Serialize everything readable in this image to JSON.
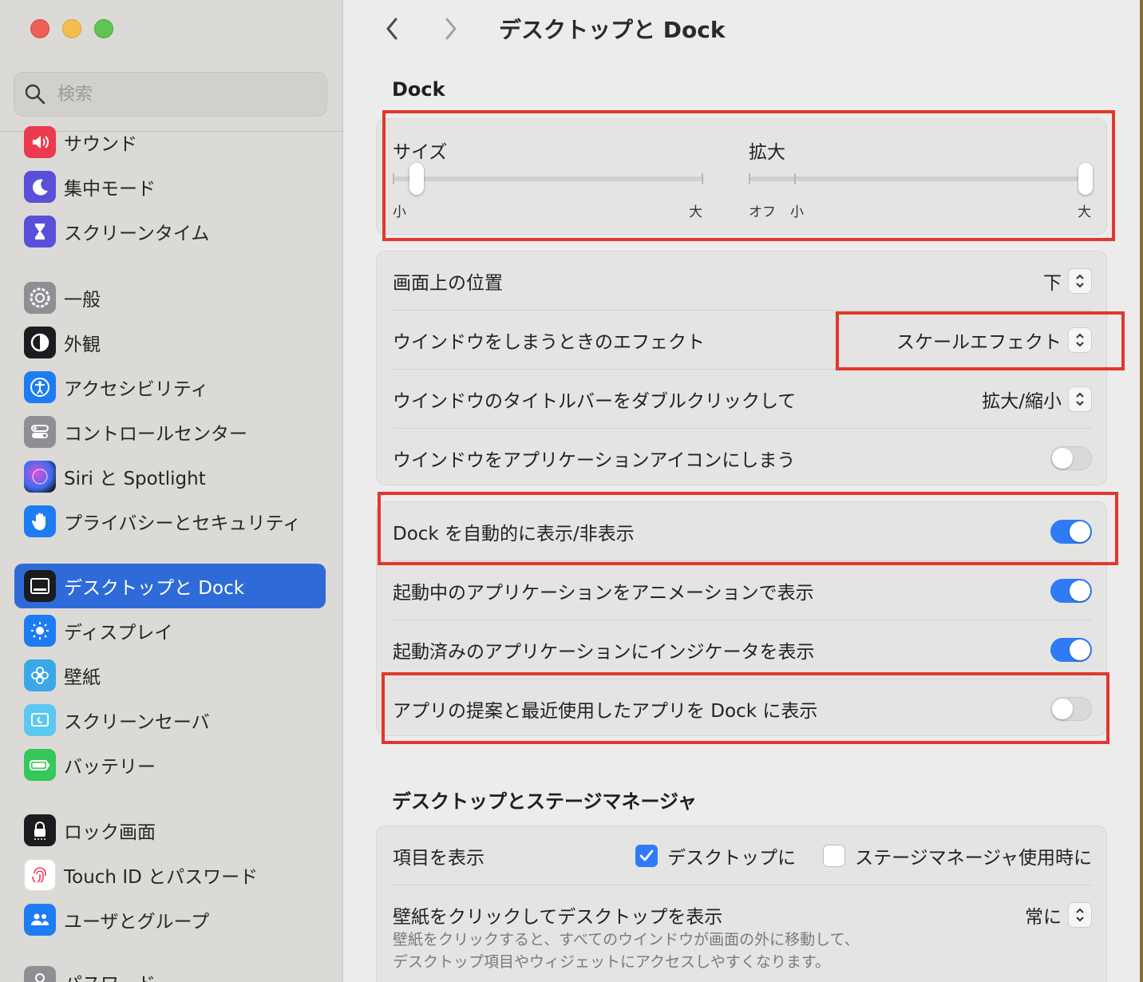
{
  "window": {
    "title": "デスクトップと Dock"
  },
  "search": {
    "placeholder": "検索"
  },
  "sidebar": {
    "items": [
      {
        "label": "サウンド",
        "icon": "speaker-icon"
      },
      {
        "label": "集中モード",
        "icon": "moon-icon"
      },
      {
        "label": "スクリーンタイム",
        "icon": "hourglass-icon"
      },
      {
        "label": "一般",
        "icon": "gear-icon"
      },
      {
        "label": "外観",
        "icon": "appearance-icon"
      },
      {
        "label": "アクセシビリティ",
        "icon": "accessibility-icon"
      },
      {
        "label": "コントロールセンター",
        "icon": "toggles-icon"
      },
      {
        "label": "Siri と Spotlight",
        "icon": "siri-icon"
      },
      {
        "label": "プライバシーとセキュリティ",
        "icon": "hand-icon"
      },
      {
        "label": "デスクトップと Dock",
        "icon": "dock-icon",
        "active": true
      },
      {
        "label": "ディスプレイ",
        "icon": "sun-icon"
      },
      {
        "label": "壁紙",
        "icon": "flower-icon"
      },
      {
        "label": "スクリーンセーバ",
        "icon": "screensaver-icon"
      },
      {
        "label": "バッテリー",
        "icon": "battery-icon"
      },
      {
        "label": "ロック画面",
        "icon": "lock-icon"
      },
      {
        "label": "Touch ID とパスワード",
        "icon": "fingerprint-icon"
      },
      {
        "label": "ユーザとグループ",
        "icon": "users-icon"
      },
      {
        "label": "パスワード",
        "icon": "key-icon"
      }
    ]
  },
  "dock": {
    "heading": "Dock",
    "size": {
      "label": "サイズ",
      "min_label": "小",
      "max_label": "大",
      "value": 0.03
    },
    "magnification": {
      "label": "拡大",
      "off_label": "オフ",
      "min_label": "小",
      "max_label": "大",
      "value": 1.0
    },
    "position": {
      "label": "画面上の位置",
      "value": "下"
    },
    "minimize_effect": {
      "label": "ウインドウをしまうときのエフェクト",
      "value": "スケールエフェクト"
    },
    "double_click": {
      "label": "ウインドウのタイトルバーをダブルクリックして",
      "value": "拡大/縮小"
    },
    "minimize_into_icon": {
      "label": "ウインドウをアプリケーションアイコンにしまう",
      "on": false
    },
    "autohide": {
      "label": "Dock を自動的に表示/非表示",
      "on": true
    },
    "animate": {
      "label": "起動中のアプリケーションをアニメーションで表示",
      "on": true
    },
    "indicators": {
      "label": "起動済みのアプリケーションにインジケータを表示",
      "on": true
    },
    "suggested": {
      "label": "アプリの提案と最近使用したアプリを Dock に表示",
      "on": false
    }
  },
  "stage": {
    "heading": "デスクトップとステージマネージャ",
    "show_items": {
      "label": "項目を表示",
      "desktop_label": "デスクトップに",
      "desktop_checked": true,
      "stage_label": "ステージマネージャ使用時に",
      "stage_checked": false
    },
    "click_wallpaper": {
      "label": "壁紙をクリックしてデスクトップを表示",
      "value": "常に",
      "desc_line1": "壁紙をクリックすると、すべてのウインドウが画面の外に移動して、",
      "desc_line2": "デスクトップ項目やウィジェットにアクセスしやすくなります。"
    }
  },
  "colors": {
    "accent": "#2f7bf6",
    "annotation": "#e0382c",
    "sidebar_active": "#2e6bd8"
  }
}
